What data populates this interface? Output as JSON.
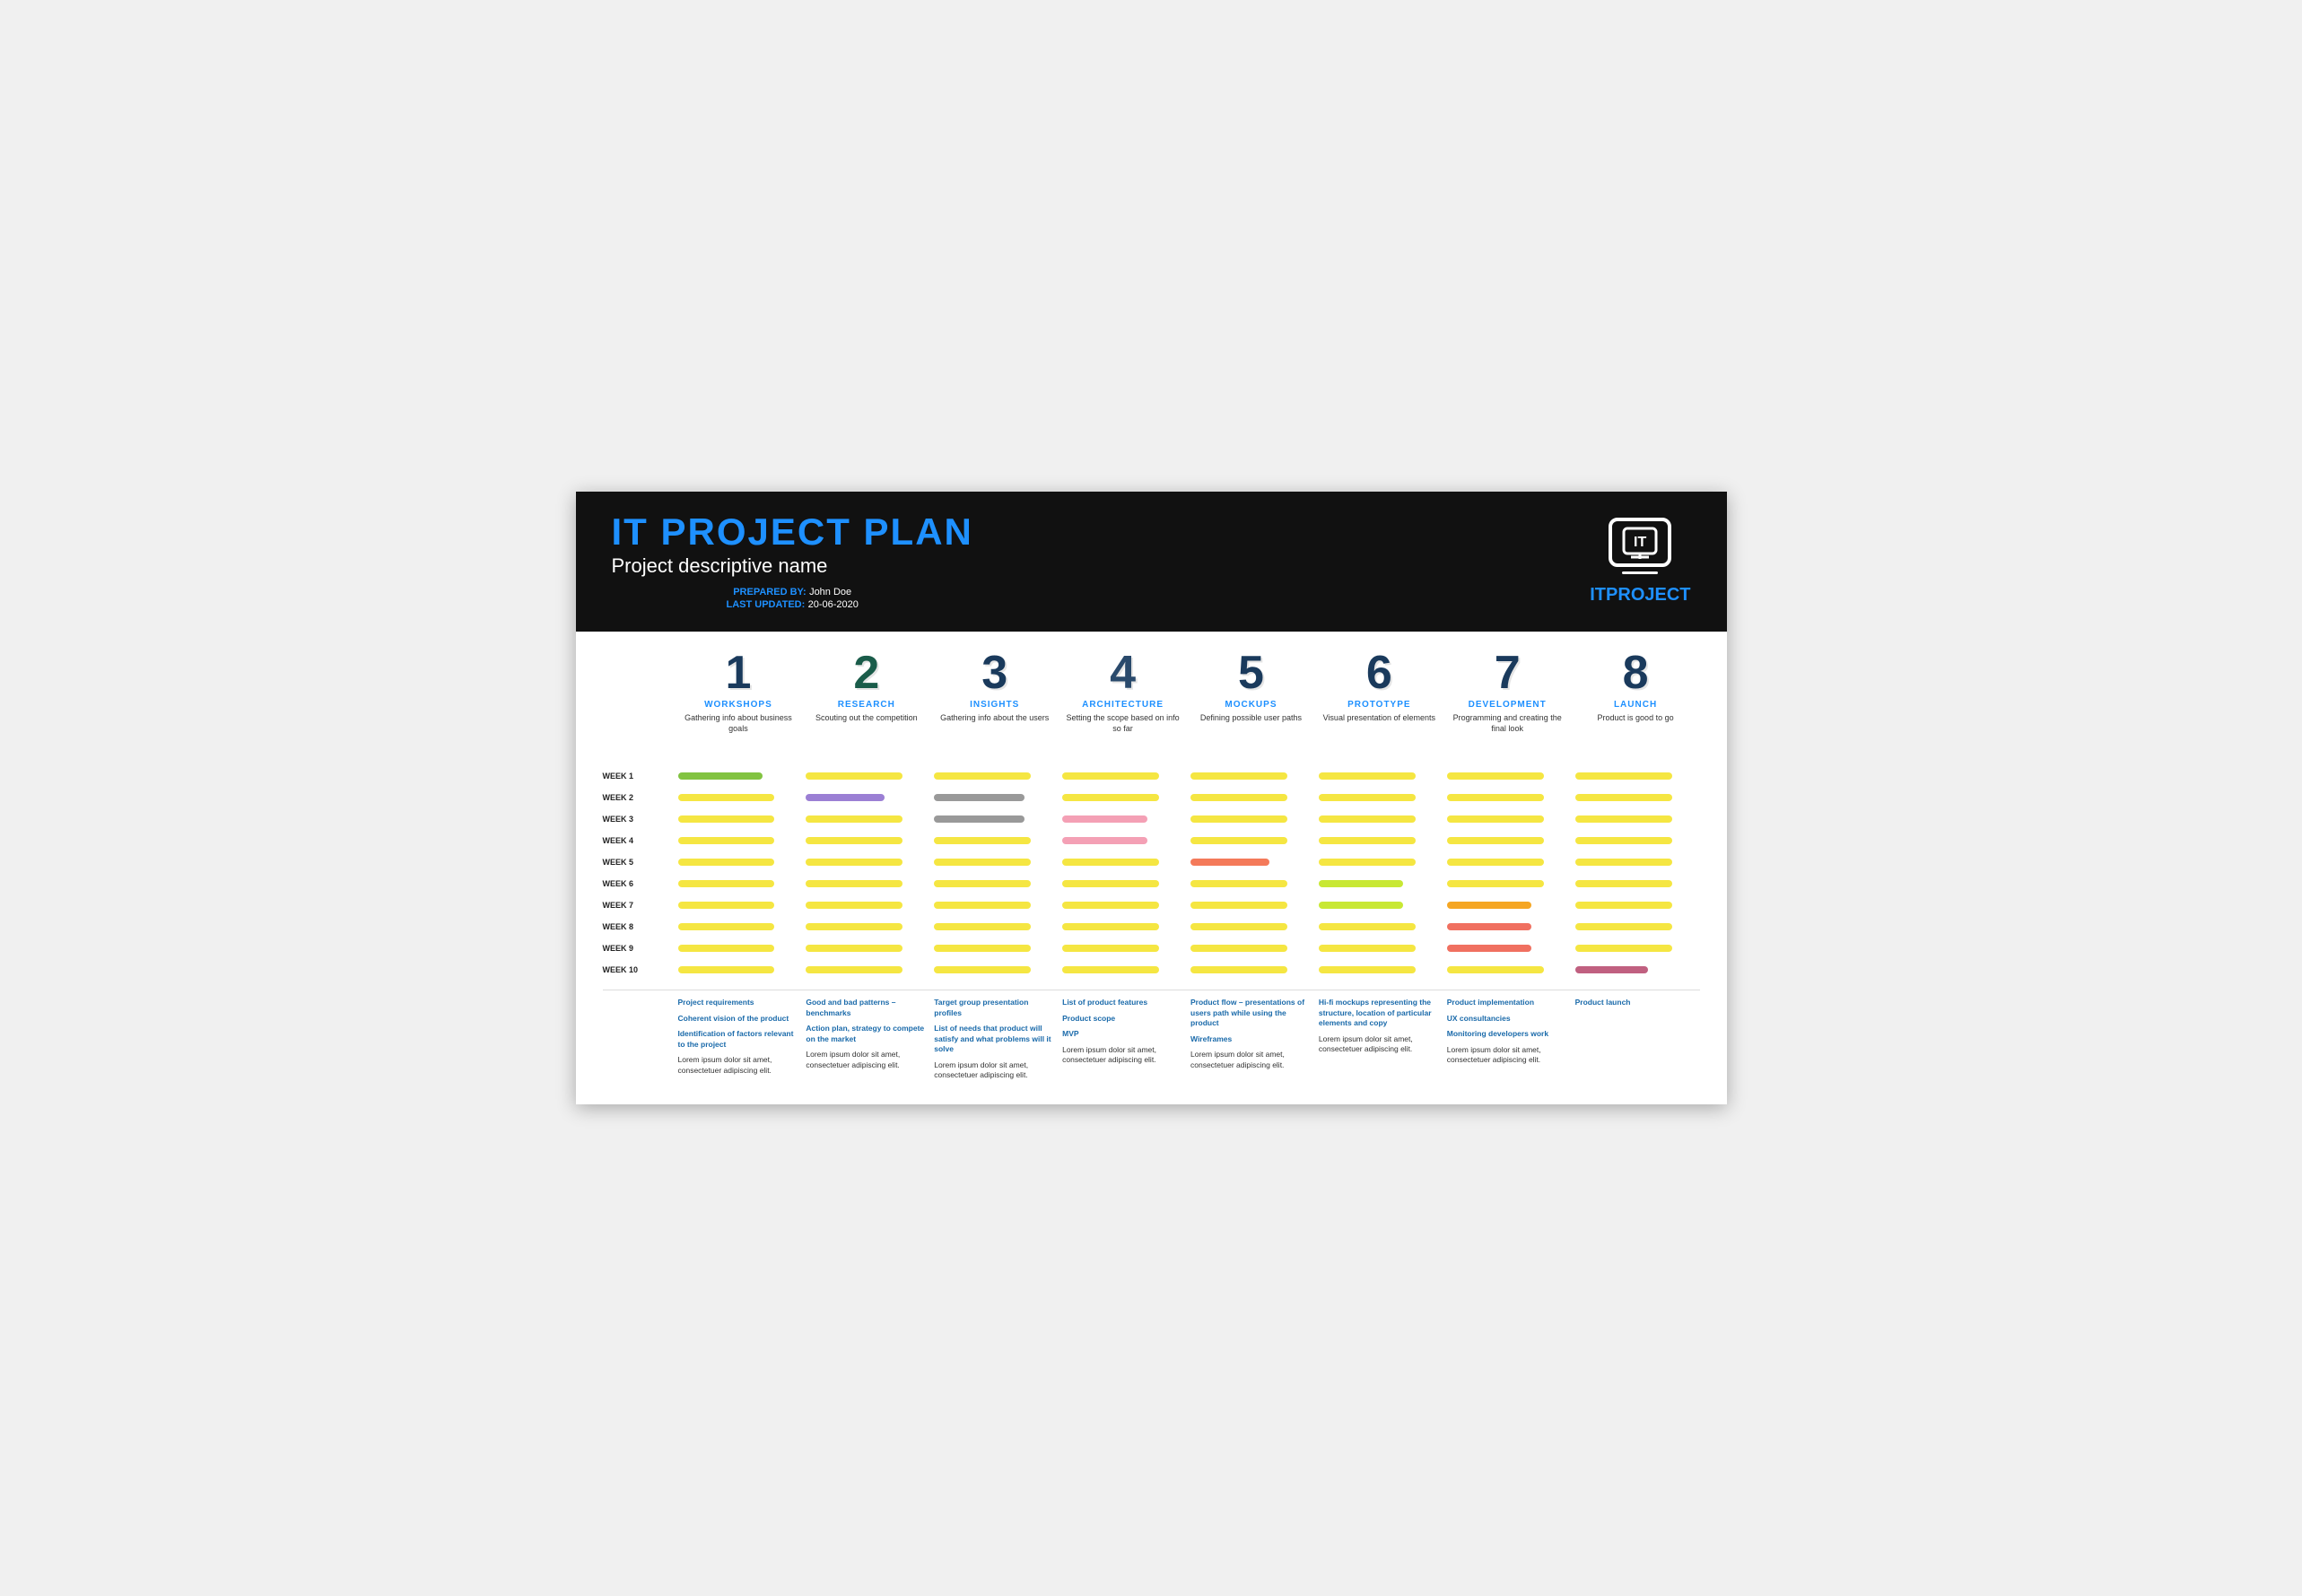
{
  "header": {
    "title": "IT PROJECT PLAN",
    "subtitle": "Project descriptive name",
    "prepared_by_label": "PREPARED BY:",
    "prepared_by_value": "John Doe",
    "last_updated_label": "LAST UPDATED:",
    "last_updated_value": "20-06-2020",
    "logo_it": "IT",
    "logo_brand": "ITPROJECT"
  },
  "phases": [
    {
      "number": "1",
      "name": "WORKSHOPS",
      "desc": "Gathering info about business goals"
    },
    {
      "number": "2",
      "name": "RESEARCH",
      "desc": "Scouting out the competition"
    },
    {
      "number": "3",
      "name": "INSIGHTS",
      "desc": "Gathering info about the users"
    },
    {
      "number": "4",
      "name": "ARCHITECTURE",
      "desc": "Setting the scope based on info so far"
    },
    {
      "number": "5",
      "name": "MOCKUPS",
      "desc": "Defining possible user paths"
    },
    {
      "number": "6",
      "name": "PROTOTYPE",
      "desc": "Visual presentation of elements"
    },
    {
      "number": "7",
      "name": "DEVELOPMENT",
      "desc": "Programming and creating the final look"
    },
    {
      "number": "8",
      "name": "LAUNCH",
      "desc": "Product is good to go"
    }
  ],
  "weeks": [
    "WEEK 1",
    "WEEK 2",
    "WEEK 3",
    "WEEK 4",
    "WEEK 5",
    "WEEK 6",
    "WEEK 7",
    "WEEK 8",
    "WEEK 9",
    "WEEK 10"
  ],
  "gantt": {
    "week1": [
      "green",
      "yellow",
      "yellow",
      "yellow",
      "yellow",
      "yellow",
      "yellow",
      "yellow"
    ],
    "week2": [
      "yellow",
      "purple",
      "gray",
      "yellow",
      "yellow",
      "yellow",
      "yellow",
      "yellow"
    ],
    "week3": [
      "yellow",
      "yellow",
      "gray",
      "pink",
      "yellow",
      "yellow",
      "yellow",
      "yellow"
    ],
    "week4": [
      "yellow",
      "yellow",
      "yellow",
      "pink",
      "yellow",
      "yellow",
      "yellow",
      "yellow"
    ],
    "week5": [
      "yellow",
      "yellow",
      "yellow",
      "yellow",
      "salmon",
      "yellow",
      "yellow",
      "yellow"
    ],
    "week6": [
      "yellow",
      "yellow",
      "yellow",
      "yellow",
      "yellow",
      "lime",
      "yellow",
      "yellow"
    ],
    "week7": [
      "yellow",
      "yellow",
      "yellow",
      "yellow",
      "yellow",
      "lime",
      "orange",
      "yellow"
    ],
    "week8": [
      "yellow",
      "yellow",
      "yellow",
      "yellow",
      "yellow",
      "yellow",
      "red-orange",
      "yellow"
    ],
    "week9": [
      "yellow",
      "yellow",
      "yellow",
      "yellow",
      "yellow",
      "yellow",
      "red-orange",
      "yellow"
    ],
    "week10": [
      "yellow",
      "yellow",
      "yellow",
      "yellow",
      "yellow",
      "yellow",
      "yellow",
      "violet"
    ]
  },
  "deliverables": [
    {
      "phase": 1,
      "items": [
        {
          "text": "Project requirements",
          "highlighted": true
        },
        {
          "text": "Coherent vision of the product",
          "highlighted": true
        },
        {
          "text": "Identification of factors relevant to the project",
          "highlighted": true
        },
        {
          "text": "Lorem ipsum dolor sit amet, consectetuer adipiscing elit.",
          "highlighted": false
        }
      ]
    },
    {
      "phase": 2,
      "items": [
        {
          "text": "Good and bad patterns – benchmarks",
          "highlighted": true
        },
        {
          "text": "Action plan, strategy to compete on the market",
          "highlighted": true
        },
        {
          "text": "Lorem ipsum dolor sit amet, consectetuer adipiscing elit.",
          "highlighted": false
        }
      ]
    },
    {
      "phase": 3,
      "items": [
        {
          "text": "Target group presentation profiles",
          "highlighted": true
        },
        {
          "text": "List of needs that product will satisfy and what problems will it solve",
          "highlighted": true
        },
        {
          "text": "Lorem ipsum dolor sit amet, consectetuer adipiscing elit.",
          "highlighted": false
        }
      ]
    },
    {
      "phase": 4,
      "items": [
        {
          "text": "List of product features",
          "highlighted": true
        },
        {
          "text": "Product scope",
          "highlighted": true
        },
        {
          "text": "MVP",
          "highlighted": true
        },
        {
          "text": "Lorem ipsum dolor sit amet, consectetuer adipiscing elit.",
          "highlighted": false
        }
      ]
    },
    {
      "phase": 5,
      "items": [
        {
          "text": "Product flow – presentations of users path while using the product",
          "highlighted": true
        },
        {
          "text": "Wireframes",
          "highlighted": true
        },
        {
          "text": "Lorem ipsum dolor sit amet, consectetuer adipiscing elit.",
          "highlighted": false
        }
      ]
    },
    {
      "phase": 6,
      "items": [
        {
          "text": "Hi-fi mockups representing the structure, location of particular elements and copy",
          "highlighted": true
        },
        {
          "text": "Lorem ipsum dolor sit amet, consectetuer adipiscing elit.",
          "highlighted": false
        }
      ]
    },
    {
      "phase": 7,
      "items": [
        {
          "text": "Product implementation",
          "highlighted": true
        },
        {
          "text": "UX consultancies",
          "highlighted": true
        },
        {
          "text": "Monitoring developers work",
          "highlighted": true
        },
        {
          "text": "Lorem ipsum dolor sit amet, consectetuer adipiscing elit.",
          "highlighted": false
        }
      ]
    },
    {
      "phase": 8,
      "items": [
        {
          "text": "Product launch",
          "highlighted": true
        }
      ]
    }
  ]
}
